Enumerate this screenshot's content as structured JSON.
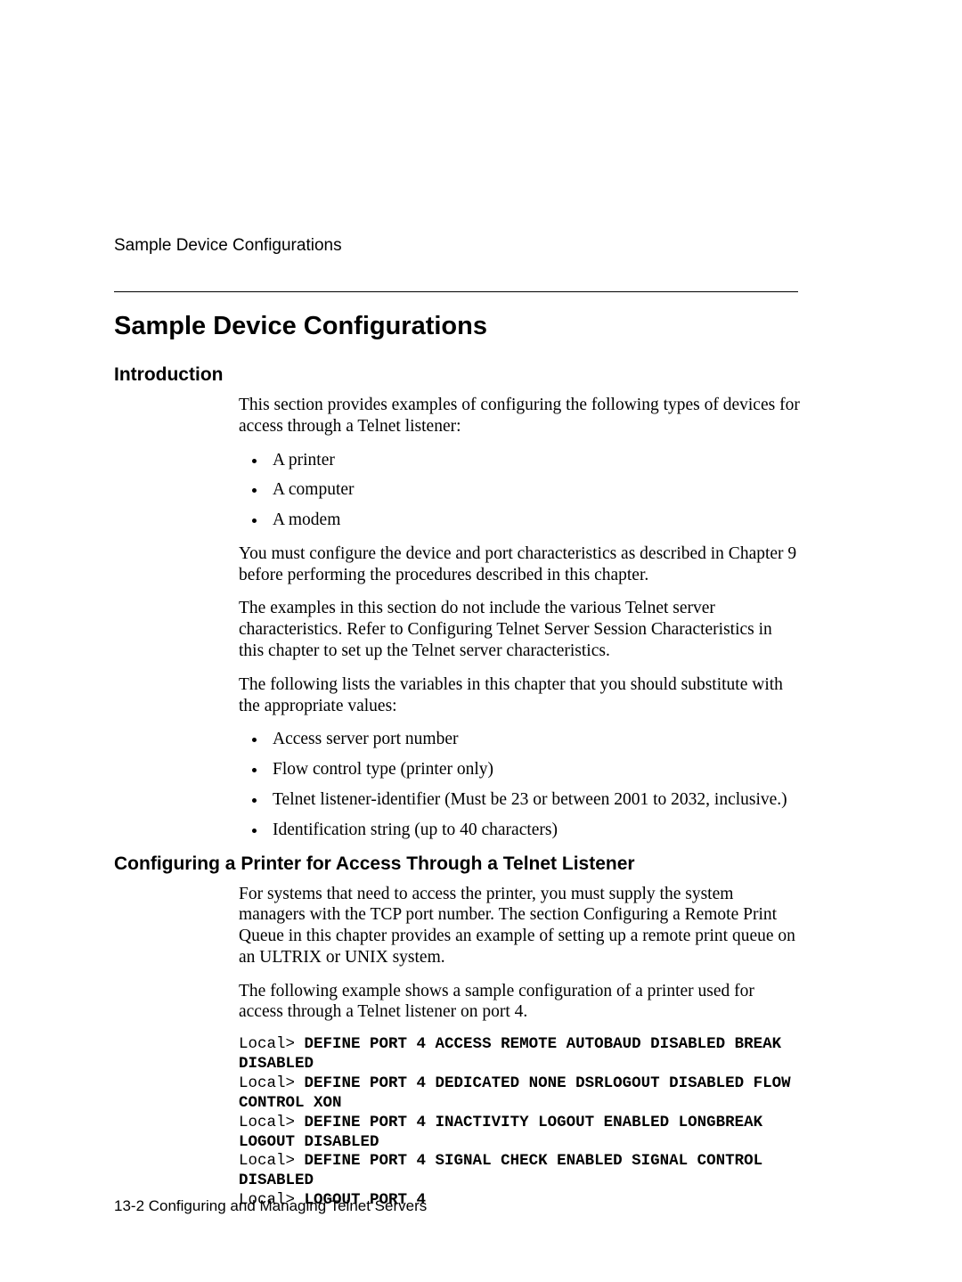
{
  "running_head": "Sample Device Configurations",
  "title": "Sample Device Configurations",
  "intro": {
    "heading": "Introduction",
    "p1": "This section provides examples of configuring the following types of devices for access through a Telnet listener:",
    "devices": [
      "A printer",
      "A computer",
      "A modem"
    ],
    "p2": "You must configure the device and port characteristics as described in Chapter 9 before performing the procedures described in this chapter.",
    "p3": "The examples in this section do not include the various Telnet server characteristics. Refer to Configuring Telnet Server Session Characteristics in this chapter to set up the Telnet server characteristics.",
    "p4": "The following lists the variables in this chapter that you should substitute with the appropriate values:",
    "vars": [
      "Access server port number",
      "Flow control type (printer only)",
      "Telnet listener-identifier (Must be 23 or between 2001 to 2032, inclusive.)",
      "Identification string (up to 40 characters)"
    ]
  },
  "printer": {
    "heading": "Configuring a Printer for Access Through a Telnet Listener",
    "p1": "For systems that need to access the printer, you must supply the system managers with the TCP port number. The section Configuring a Remote Print Queue in this chapter provides an example of setting up a remote print queue on an ULTRIX or UNIX system.",
    "p2": "The following example shows a sample configuration of a printer used for access through a Telnet listener on port 4.",
    "prompt": "Local>",
    "cmds": {
      "l1": "DEFINE PORT 4 ACCESS REMOTE AUTOBAUD DISABLED BREAK DISABLED",
      "l2": "DEFINE PORT 4 DEDICATED NONE DSRLOGOUT DISABLED FLOW CONTROL XON",
      "l3": "DEFINE PORT 4 INACTIVITY LOGOUT ENABLED LONGBREAK LOGOUT DISABLED",
      "l4": "DEFINE PORT 4 SIGNAL CHECK ENABLED SIGNAL CONTROL DISABLED",
      "l5": "LOGOUT PORT 4"
    }
  },
  "footer": "13-2  Configuring and Managing Telnet Servers"
}
